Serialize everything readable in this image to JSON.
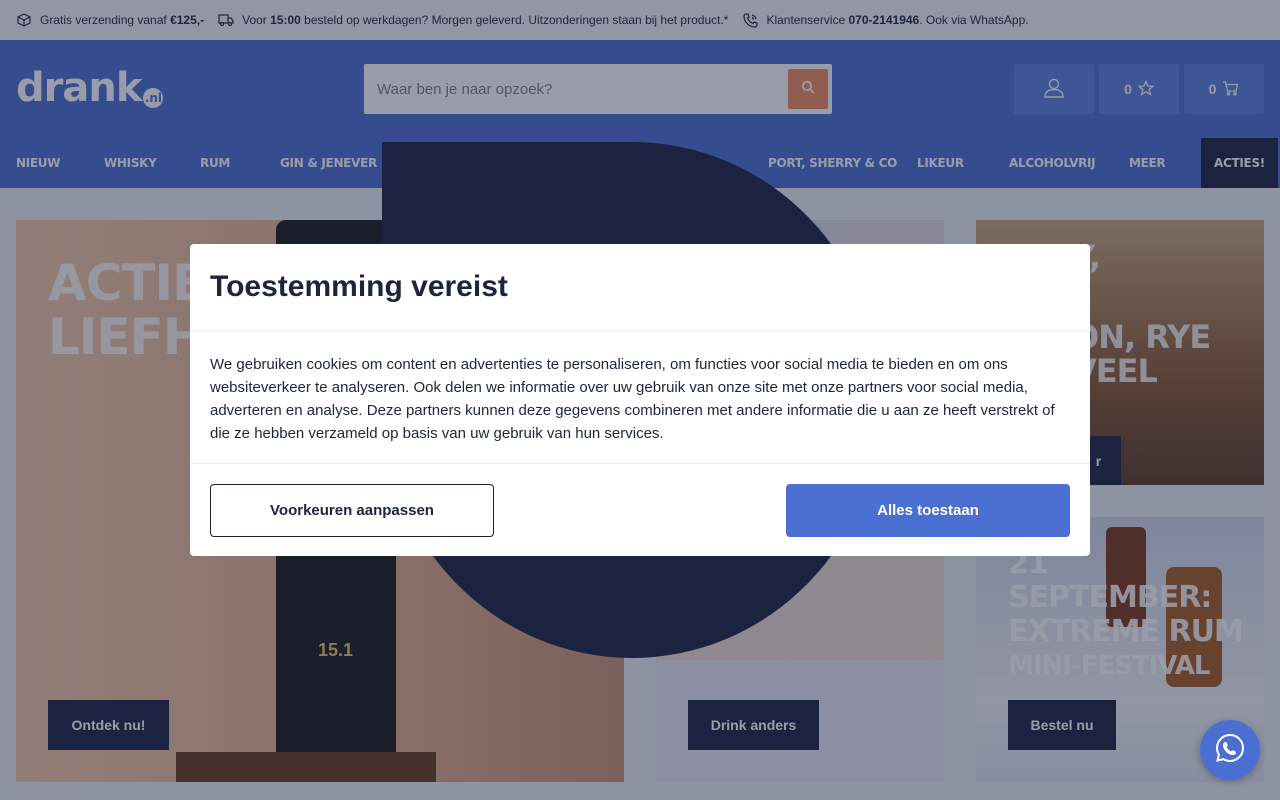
{
  "topbar": {
    "shipping_pre": "Gratis verzending vanaf ",
    "shipping_amount": "€125,-",
    "delivery_pre": "Voor ",
    "delivery_time": "15:00",
    "delivery_post": " besteld op werkdagen? Morgen geleverd. Uitzonderingen staan bij het product.*",
    "service_pre": "Klantenservice ",
    "service_phone": "070-2141946",
    "service_post": ". Ook via WhatsApp."
  },
  "header": {
    "logo": "drank",
    "logo_suffix": ".nl",
    "search_placeholder": "Waar ben je naar opzoek?",
    "favorites_count": "0",
    "cart_count": "0"
  },
  "nav": {
    "items": [
      "Nieuw",
      "Whisky",
      "Rum",
      "Gin & Jenever",
      "Port, Sherry & Co",
      "Likeur",
      "Alcoholvrij",
      "Meer",
      "Acties!"
    ]
  },
  "cards": {
    "left_text_1": "Acties!",
    "left_text_2": "Liefhe",
    "left_button": "Ontdek nu!",
    "middle_button": "Drink anders",
    "right_top_text_1": "y,",
    "right_top_text_2": "on, Rye",
    "right_top_text_3": "veel",
    "right_top_button_frag": "r",
    "right_bottom_text_1": "21",
    "right_bottom_text_2": "September:",
    "right_bottom_text_3": "Extreme Rum",
    "right_bottom_text_4": "Mini-festival",
    "right_bottom_button": "Bestel nu",
    "bottle_label": "15.1"
  },
  "modal": {
    "title": "Toestemming vereist",
    "body": "We gebruiken cookies om content en advertenties te personaliseren, om functies voor social media te bieden en om ons websiteverkeer te analyseren. Ook delen we informatie over uw gebruik van onze site met onze partners voor social media, adverteren en analyse. Deze partners kunnen deze gegevens combineren met andere informatie die u aan ze heeft verstrekt of die ze hebben verzameld op basis van uw gebruik van hun services.",
    "preferences_label": "Voorkeuren aanpassen",
    "accept_label": "Alles toestaan"
  },
  "colors": {
    "brand_blue": "#4a6fd0",
    "dark_navy": "#1d2440",
    "search_orange": "#f08a5d"
  }
}
